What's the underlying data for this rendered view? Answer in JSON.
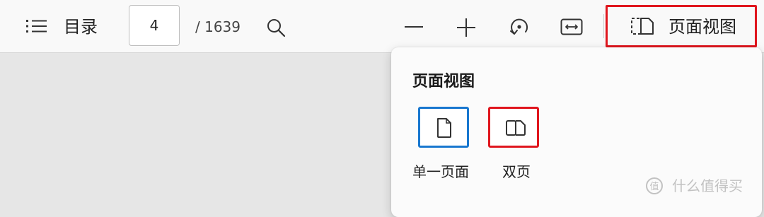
{
  "toolbar": {
    "toc_label": "目录",
    "page_current": "4",
    "page_total": "/ 1639",
    "view_button_label": "页面视图",
    "icons": [
      "list-icon",
      "search-icon",
      "minus-icon",
      "plus-icon",
      "rotate-icon",
      "fit-width-icon",
      "page-view-icon"
    ]
  },
  "popup": {
    "title": "页面视图",
    "options": [
      {
        "label": "单一页面",
        "icon": "single-page-icon",
        "selected": true
      },
      {
        "label": "双页",
        "icon": "double-page-icon",
        "selected": false
      }
    ]
  },
  "watermark": {
    "text": "什么值得买"
  },
  "colors": {
    "selected_border": "#1877cf",
    "highlight_red": "#e0161e",
    "toolbar_bg": "#f9f9f9",
    "canvas_bg": "#e6e6e6"
  }
}
